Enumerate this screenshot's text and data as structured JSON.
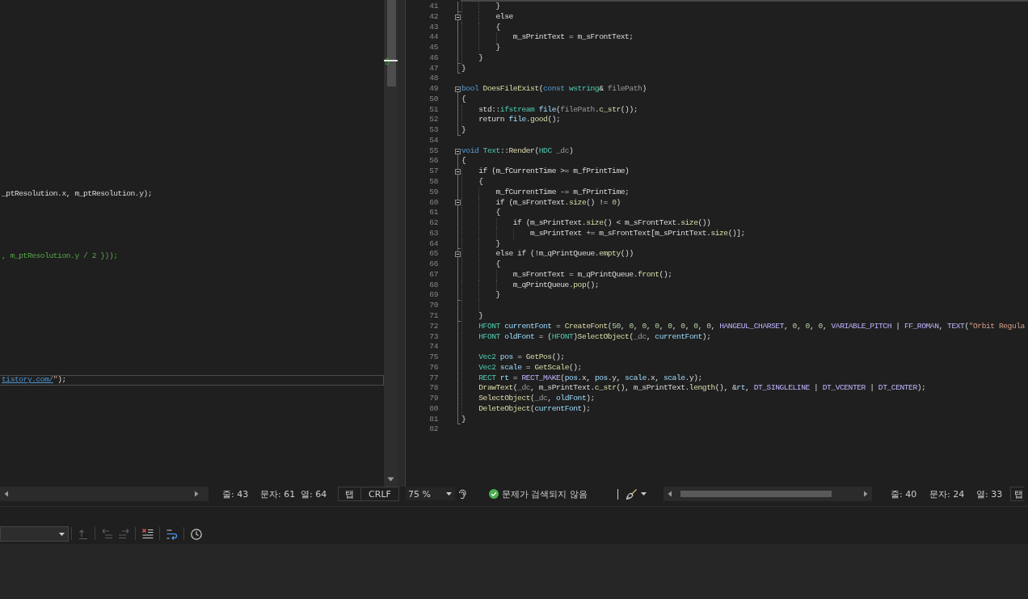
{
  "left_editor": {
    "lines": [
      {
        "kind": "blank"
      },
      {
        "kind": "blank"
      },
      {
        "kind": "blank"
      },
      {
        "kind": "blank"
      },
      {
        "kind": "blank"
      },
      {
        "kind": "blank"
      },
      {
        "kind": "blank"
      },
      {
        "kind": "blank"
      },
      {
        "kind": "blank"
      },
      {
        "kind": "blank"
      },
      {
        "kind": "blank"
      },
      {
        "kind": "blank"
      },
      {
        "kind": "blank"
      },
      {
        "kind": "blank"
      },
      {
        "kind": "blank"
      },
      {
        "kind": "blank"
      },
      {
        "kind": "blank"
      },
      {
        "kind": "blank"
      },
      {
        "kind": "code",
        "current": false,
        "tokens": [
          {
            "text": "_ptResolution.x, m_ptResolution.y);",
            "kind": "plain"
          }
        ]
      },
      {
        "kind": "blank"
      },
      {
        "kind": "blank"
      },
      {
        "kind": "blank"
      },
      {
        "kind": "blank"
      },
      {
        "kind": "blank"
      },
      {
        "kind": "code",
        "current": false,
        "tokens": [
          {
            "text": ", m_ptResolution.y / 2 }));",
            "kind": "comment"
          }
        ]
      },
      {
        "kind": "blank"
      },
      {
        "kind": "blank"
      },
      {
        "kind": "blank"
      },
      {
        "kind": "blank"
      },
      {
        "kind": "blank"
      },
      {
        "kind": "blank"
      },
      {
        "kind": "blank"
      },
      {
        "kind": "blank"
      },
      {
        "kind": "blank"
      },
      {
        "kind": "blank"
      },
      {
        "kind": "blank"
      },
      {
        "kind": "code",
        "current": true,
        "tokens": [
          {
            "text": "tistory.com/",
            "kind": "link"
          },
          {
            "text": "\"",
            "kind": "string"
          },
          {
            "text": ");",
            "kind": "plain"
          }
        ]
      }
    ]
  },
  "right_editor": {
    "lines": [
      {
        "number": "41",
        "kind": "blockend",
        "tokens": [
          {
            "text": "        }",
            "kind": "plain"
          }
        ]
      },
      {
        "number": "42",
        "kind": "foldstart",
        "tokens": [
          {
            "text": "        else",
            "kind": "plain"
          }
        ]
      },
      {
        "number": "43",
        "kind": "inner",
        "tokens": [
          {
            "text": "        {",
            "kind": "plain"
          }
        ]
      },
      {
        "number": "44",
        "kind": "inner",
        "tokens": [
          {
            "text": "            m_sPrintText = m_sFrontText;",
            "kind": "plain"
          }
        ]
      },
      {
        "number": "45",
        "kind": "inner",
        "tokens": [
          {
            "text": "        }",
            "kind": "plain"
          }
        ]
      },
      {
        "number": "46",
        "kind": "blockend",
        "tokens": [
          {
            "text": "    }",
            "kind": "plain"
          }
        ]
      },
      {
        "number": "47",
        "kind": "blockend",
        "tokens": [
          {
            "text": "}",
            "kind": "plain"
          }
        ]
      },
      {
        "number": "48",
        "kind": "outer"
      },
      {
        "number": "49",
        "kind": "foldstart",
        "tokens": [
          {
            "text": "bool ",
            "kind": "keyword"
          },
          {
            "text": "DoesFileExist",
            "kind": "function"
          },
          {
            "text": "(",
            "kind": "plain"
          },
          {
            "text": "const ",
            "kind": "keyword"
          },
          {
            "text": "wstring",
            "kind": "type"
          },
          {
            "text": "& ",
            "kind": "plain"
          },
          {
            "text": "filePath",
            "kind": "param"
          },
          {
            "text": ")",
            "kind": "plain"
          }
        ]
      },
      {
        "number": "50",
        "kind": "inner",
        "tokens": [
          {
            "text": "{",
            "kind": "plain"
          }
        ]
      },
      {
        "number": "51",
        "kind": "inner",
        "tokens": [
          {
            "text": "    std::",
            "kind": "plain"
          },
          {
            "text": "ifstream ",
            "kind": "type"
          },
          {
            "text": "file",
            "kind": "local"
          },
          {
            "text": "(",
            "kind": "plain"
          },
          {
            "text": "filePath",
            "kind": "param"
          },
          {
            "text": ".",
            "kind": "plain"
          },
          {
            "text": "c_str",
            "kind": "function"
          },
          {
            "text": "());",
            "kind": "plain"
          }
        ]
      },
      {
        "number": "52",
        "kind": "inner",
        "tokens": [
          {
            "text": "    return ",
            "kind": "plain"
          },
          {
            "text": "file",
            "kind": "local"
          },
          {
            "text": ".",
            "kind": "plain"
          },
          {
            "text": "good",
            "kind": "function"
          },
          {
            "text": "();",
            "kind": "plain"
          }
        ]
      },
      {
        "number": "53",
        "kind": "blockend",
        "tokens": [
          {
            "text": "}",
            "kind": "plain"
          }
        ]
      },
      {
        "number": "54",
        "kind": "outer"
      },
      {
        "number": "55",
        "kind": "foldstart",
        "tokens": [
          {
            "text": "void ",
            "kind": "keyword"
          },
          {
            "text": "Text",
            "kind": "type"
          },
          {
            "text": "::",
            "kind": "plain"
          },
          {
            "text": "Render",
            "kind": "function"
          },
          {
            "text": "(",
            "kind": "plain"
          },
          {
            "text": "HDC ",
            "kind": "type"
          },
          {
            "text": "_dc",
            "kind": "param"
          },
          {
            "text": ")",
            "kind": "plain"
          }
        ]
      },
      {
        "number": "56",
        "kind": "inner",
        "tokens": [
          {
            "text": "{",
            "kind": "plain"
          }
        ]
      },
      {
        "number": "57",
        "kind": "foldstart",
        "tokens": [
          {
            "text": "    if (m_fCurrentTime >= m_fPrintTime)",
            "kind": "plain"
          }
        ]
      },
      {
        "number": "58",
        "kind": "inner",
        "tokens": [
          {
            "text": "    {",
            "kind": "plain"
          }
        ]
      },
      {
        "number": "59",
        "kind": "inner",
        "tokens": [
          {
            "text": "        m_fCurrentTime -= m_fPrintTime;",
            "kind": "plain"
          }
        ]
      },
      {
        "number": "60",
        "kind": "foldstart",
        "tokens": [
          {
            "text": "        if (m_sFrontText.",
            "kind": "plain"
          },
          {
            "text": "size",
            "kind": "function"
          },
          {
            "text": "() != ",
            "kind": "plain"
          },
          {
            "text": "0",
            "kind": "number"
          },
          {
            "text": ")",
            "kind": "plain"
          }
        ]
      },
      {
        "number": "61",
        "kind": "inner",
        "tokens": [
          {
            "text": "        {",
            "kind": "plain"
          }
        ]
      },
      {
        "number": "62",
        "kind": "inner",
        "tokens": [
          {
            "text": "            if (m_sPrintText.",
            "kind": "plain"
          },
          {
            "text": "size",
            "kind": "function"
          },
          {
            "text": "() < m_sFrontText.",
            "kind": "plain"
          },
          {
            "text": "size",
            "kind": "function"
          },
          {
            "text": "())",
            "kind": "plain"
          }
        ]
      },
      {
        "number": "63",
        "kind": "inner",
        "tokens": [
          {
            "text": "                m_sPrintText += m_sFrontText[m_sPrintText.",
            "kind": "plain"
          },
          {
            "text": "size",
            "kind": "function"
          },
          {
            "text": "()];",
            "kind": "plain"
          }
        ]
      },
      {
        "number": "64",
        "kind": "blockend",
        "tokens": [
          {
            "text": "        }",
            "kind": "plain"
          }
        ]
      },
      {
        "number": "65",
        "kind": "foldstart",
        "tokens": [
          {
            "text": "        else if (!m_qPrintQueue.",
            "kind": "plain"
          },
          {
            "text": "empty",
            "kind": "function"
          },
          {
            "text": "())",
            "kind": "plain"
          }
        ]
      },
      {
        "number": "66",
        "kind": "inner",
        "tokens": [
          {
            "text": "        {",
            "kind": "plain"
          }
        ]
      },
      {
        "number": "67",
        "kind": "inner",
        "tokens": [
          {
            "text": "            m_sFrontText = m_qPrintQueue.",
            "kind": "plain"
          },
          {
            "text": "front",
            "kind": "function"
          },
          {
            "text": "();",
            "kind": "plain"
          }
        ]
      },
      {
        "number": "68",
        "kind": "inner",
        "tokens": [
          {
            "text": "            m_qPrintQueue.",
            "kind": "plain"
          },
          {
            "text": "pop",
            "kind": "function"
          },
          {
            "text": "();",
            "kind": "plain"
          }
        ]
      },
      {
        "number": "69",
        "kind": "blockend",
        "tokens": [
          {
            "text": "        }",
            "kind": "plain"
          }
        ]
      },
      {
        "number": "70",
        "kind": "inner"
      },
      {
        "number": "71",
        "kind": "blockend",
        "tokens": [
          {
            "text": "    }",
            "kind": "plain"
          }
        ]
      },
      {
        "number": "72",
        "kind": "inner",
        "tokens": [
          {
            "text": "    HFONT ",
            "kind": "type"
          },
          {
            "text": "currentFont",
            "kind": "local"
          },
          {
            "text": " = ",
            "kind": "plain"
          },
          {
            "text": "CreateFont",
            "kind": "function"
          },
          {
            "text": "(",
            "kind": "plain"
          },
          {
            "text": "50",
            "kind": "number"
          },
          {
            "text": ", ",
            "kind": "plain"
          },
          {
            "text": "0",
            "kind": "number"
          },
          {
            "text": ", ",
            "kind": "plain"
          },
          {
            "text": "0",
            "kind": "number"
          },
          {
            "text": ", ",
            "kind": "plain"
          },
          {
            "text": "0",
            "kind": "number"
          },
          {
            "text": ", ",
            "kind": "plain"
          },
          {
            "text": "0",
            "kind": "number"
          },
          {
            "text": ", ",
            "kind": "plain"
          },
          {
            "text": "0",
            "kind": "number"
          },
          {
            "text": ", ",
            "kind": "plain"
          },
          {
            "text": "0",
            "kind": "number"
          },
          {
            "text": ", ",
            "kind": "plain"
          },
          {
            "text": "0",
            "kind": "number"
          },
          {
            "text": ", ",
            "kind": "plain"
          },
          {
            "text": "HANGEUL_CHARSET",
            "kind": "macro"
          },
          {
            "text": ", ",
            "kind": "plain"
          },
          {
            "text": "0",
            "kind": "number"
          },
          {
            "text": ", ",
            "kind": "plain"
          },
          {
            "text": "0",
            "kind": "number"
          },
          {
            "text": ", ",
            "kind": "plain"
          },
          {
            "text": "0",
            "kind": "number"
          },
          {
            "text": ", ",
            "kind": "plain"
          },
          {
            "text": "VARIABLE_PITCH",
            "kind": "macro"
          },
          {
            "text": " | ",
            "kind": "plain"
          },
          {
            "text": "FF_ROMAN",
            "kind": "macro"
          },
          {
            "text": ", ",
            "kind": "plain"
          },
          {
            "text": "TEXT",
            "kind": "macro"
          },
          {
            "text": "(",
            "kind": "plain"
          },
          {
            "text": "\"Orbit Regula",
            "kind": "string"
          }
        ]
      },
      {
        "number": "73",
        "kind": "inner",
        "tokens": [
          {
            "text": "    HFONT ",
            "kind": "type"
          },
          {
            "text": "oldFont",
            "kind": "local"
          },
          {
            "text": " = (",
            "kind": "plain"
          },
          {
            "text": "HFONT",
            "kind": "type"
          },
          {
            "text": ")",
            "kind": "plain"
          },
          {
            "text": "SelectObject",
            "kind": "function"
          },
          {
            "text": "(",
            "kind": "plain"
          },
          {
            "text": "_dc",
            "kind": "param"
          },
          {
            "text": ", ",
            "kind": "plain"
          },
          {
            "text": "currentFont",
            "kind": "local"
          },
          {
            "text": ");",
            "kind": "plain"
          }
        ]
      },
      {
        "number": "74",
        "kind": "inner"
      },
      {
        "number": "75",
        "kind": "inner",
        "tokens": [
          {
            "text": "    Vec2 ",
            "kind": "type"
          },
          {
            "text": "pos",
            "kind": "local"
          },
          {
            "text": " = ",
            "kind": "plain"
          },
          {
            "text": "GetPos",
            "kind": "function"
          },
          {
            "text": "();",
            "kind": "plain"
          }
        ]
      },
      {
        "number": "76",
        "kind": "inner",
        "tokens": [
          {
            "text": "    Vec2 ",
            "kind": "type"
          },
          {
            "text": "scale",
            "kind": "local"
          },
          {
            "text": " = ",
            "kind": "plain"
          },
          {
            "text": "GetScale",
            "kind": "function"
          },
          {
            "text": "();",
            "kind": "plain"
          }
        ]
      },
      {
        "number": "77",
        "kind": "inner",
        "tokens": [
          {
            "text": "    RECT ",
            "kind": "type"
          },
          {
            "text": "rt",
            "kind": "local"
          },
          {
            "text": " = ",
            "kind": "plain"
          },
          {
            "text": "RECT_MAKE",
            "kind": "macro"
          },
          {
            "text": "(",
            "kind": "plain"
          },
          {
            "text": "pos",
            "kind": "local"
          },
          {
            "text": ".x, ",
            "kind": "plain"
          },
          {
            "text": "pos",
            "kind": "local"
          },
          {
            "text": ".y, ",
            "kind": "plain"
          },
          {
            "text": "scale",
            "kind": "local"
          },
          {
            "text": ".x, ",
            "kind": "plain"
          },
          {
            "text": "scale",
            "kind": "local"
          },
          {
            "text": ".y);",
            "kind": "plain"
          }
        ]
      },
      {
        "number": "78",
        "kind": "inner",
        "tokens": [
          {
            "text": "    DrawText",
            "kind": "function"
          },
          {
            "text": "(",
            "kind": "plain"
          },
          {
            "text": "_dc",
            "kind": "param"
          },
          {
            "text": ", m_sPrintText.",
            "kind": "plain"
          },
          {
            "text": "c_str",
            "kind": "function"
          },
          {
            "text": "(), m_sPrintText.",
            "kind": "plain"
          },
          {
            "text": "length",
            "kind": "function"
          },
          {
            "text": "(), &",
            "kind": "plain"
          },
          {
            "text": "rt",
            "kind": "local"
          },
          {
            "text": ", ",
            "kind": "plain"
          },
          {
            "text": "DT_SINGLELINE",
            "kind": "macro"
          },
          {
            "text": " | ",
            "kind": "plain"
          },
          {
            "text": "DT_VCENTER",
            "kind": "macro"
          },
          {
            "text": " | ",
            "kind": "plain"
          },
          {
            "text": "DT_CENTER",
            "kind": "macro"
          },
          {
            "text": ");",
            "kind": "plain"
          }
        ]
      },
      {
        "number": "79",
        "kind": "inner",
        "tokens": [
          {
            "text": "    SelectObject",
            "kind": "function"
          },
          {
            "text": "(",
            "kind": "plain"
          },
          {
            "text": "_dc",
            "kind": "param"
          },
          {
            "text": ", ",
            "kind": "plain"
          },
          {
            "text": "oldFont",
            "kind": "local"
          },
          {
            "text": ");",
            "kind": "plain"
          }
        ]
      },
      {
        "number": "80",
        "kind": "inner",
        "tokens": [
          {
            "text": "    DeleteObject",
            "kind": "function"
          },
          {
            "text": "(",
            "kind": "plain"
          },
          {
            "text": "currentFont",
            "kind": "local"
          },
          {
            "text": ");",
            "kind": "plain"
          }
        ]
      },
      {
        "number": "81",
        "kind": "blockend",
        "tokens": [
          {
            "text": "}",
            "kind": "plain"
          }
        ]
      },
      {
        "number": "82",
        "kind": "outer"
      }
    ]
  },
  "left_status": {
    "line": "줄: 43",
    "character": "문자: 61",
    "column": "열: 64",
    "indentation": "탭",
    "line_ending": "CRLF"
  },
  "right_status": {
    "zoom": "75 %",
    "issues": "문제가 검색되지 않음",
    "line": "줄: 40",
    "character": "문자: 24",
    "column": "열: 33",
    "indentation": "탭"
  },
  "output_toolbar": {
    "buttons": [
      {
        "kind": "find-in-code",
        "disabled": true
      },
      {
        "kind": "previous-message",
        "disabled": true
      },
      {
        "kind": "next-message",
        "disabled": true
      },
      {
        "kind": "clear-all",
        "disabled": false
      },
      {
        "kind": "word-wrap",
        "disabled": false
      },
      {
        "kind": "timestamps",
        "disabled": false
      }
    ]
  }
}
